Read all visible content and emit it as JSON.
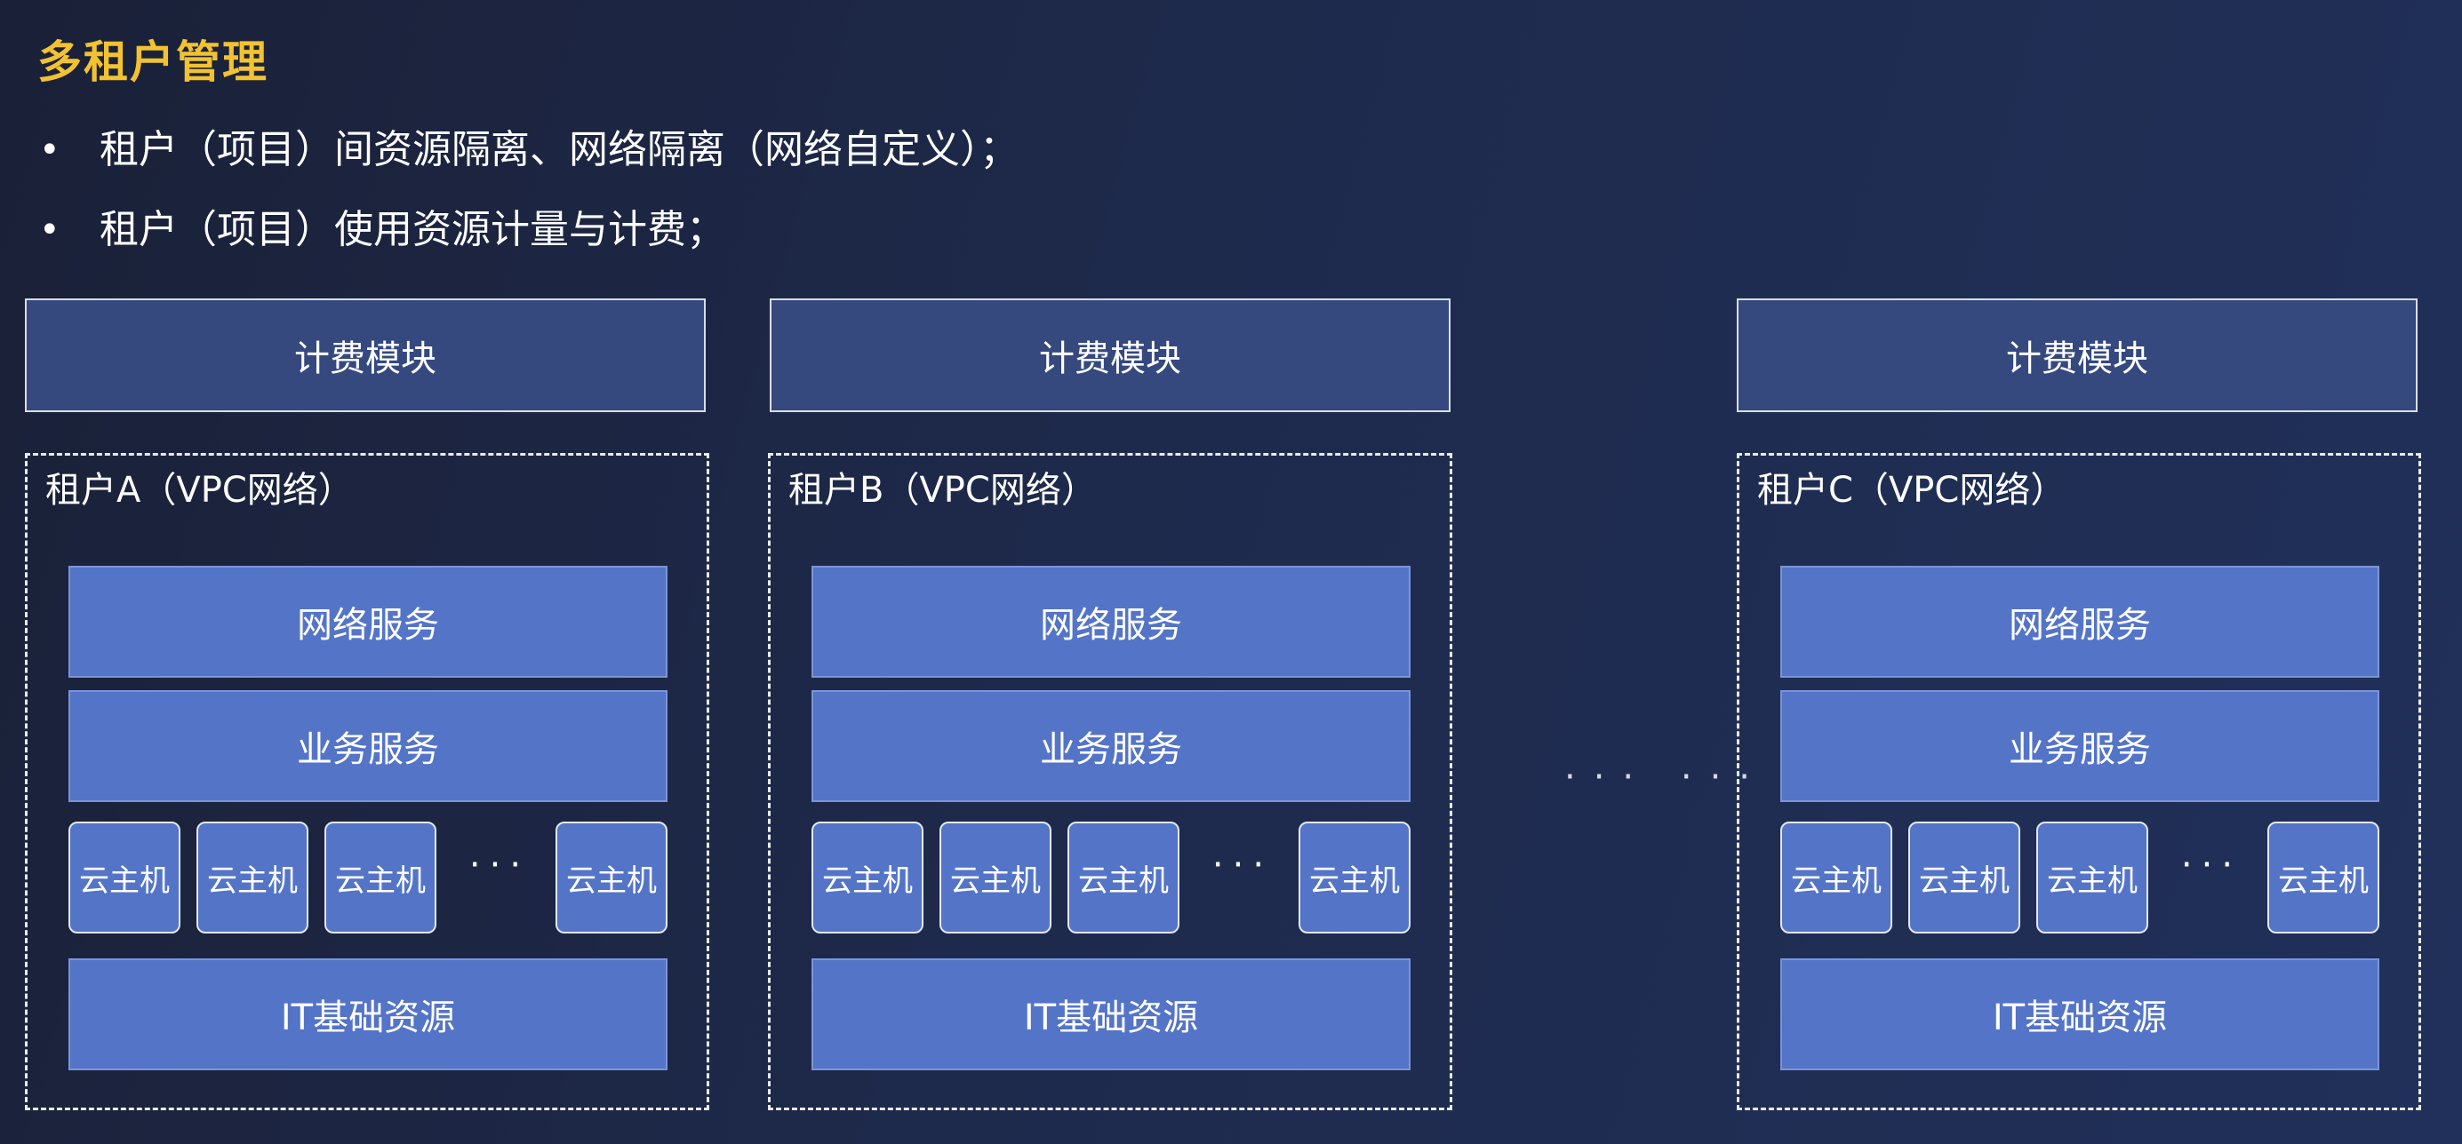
{
  "title": "多租户管理",
  "bullets": [
    {
      "text": "租户（项目）间资源隔离、网络隔离（网络自定义）；"
    },
    {
      "text": "租户（项目）使用资源计量与计费；"
    }
  ],
  "bullet_symbol": "•",
  "tenants": [
    {
      "billing": "计费模块",
      "name": "租户A（VPC网络）",
      "network": "网络服务",
      "business": "业务服务",
      "vms": [
        "云主机",
        "云主机",
        "云主机",
        "云主机"
      ],
      "ellipsis": "···",
      "infra": "IT基础资源"
    },
    {
      "billing": "计费模块",
      "name": "租户B（VPC网络）",
      "network": "网络服务",
      "business": "业务服务",
      "vms": [
        "云主机",
        "云主机",
        "云主机",
        "云主机"
      ],
      "ellipsis": "···",
      "infra": "IT基础资源"
    },
    {
      "billing": "计费模块",
      "name": "租户C（VPC网络）",
      "network": "网络服务",
      "business": "业务服务",
      "vms": [
        "云主机",
        "云主机",
        "云主机",
        "云主机"
      ],
      "ellipsis": "···",
      "infra": "IT基础资源"
    }
  ],
  "between_ellipsis": "··· ···",
  "colors": {
    "title": "#f2c230",
    "billing_fill": "#35497f",
    "layer_fill": "#5474c8",
    "background": "#1e2a4c"
  }
}
